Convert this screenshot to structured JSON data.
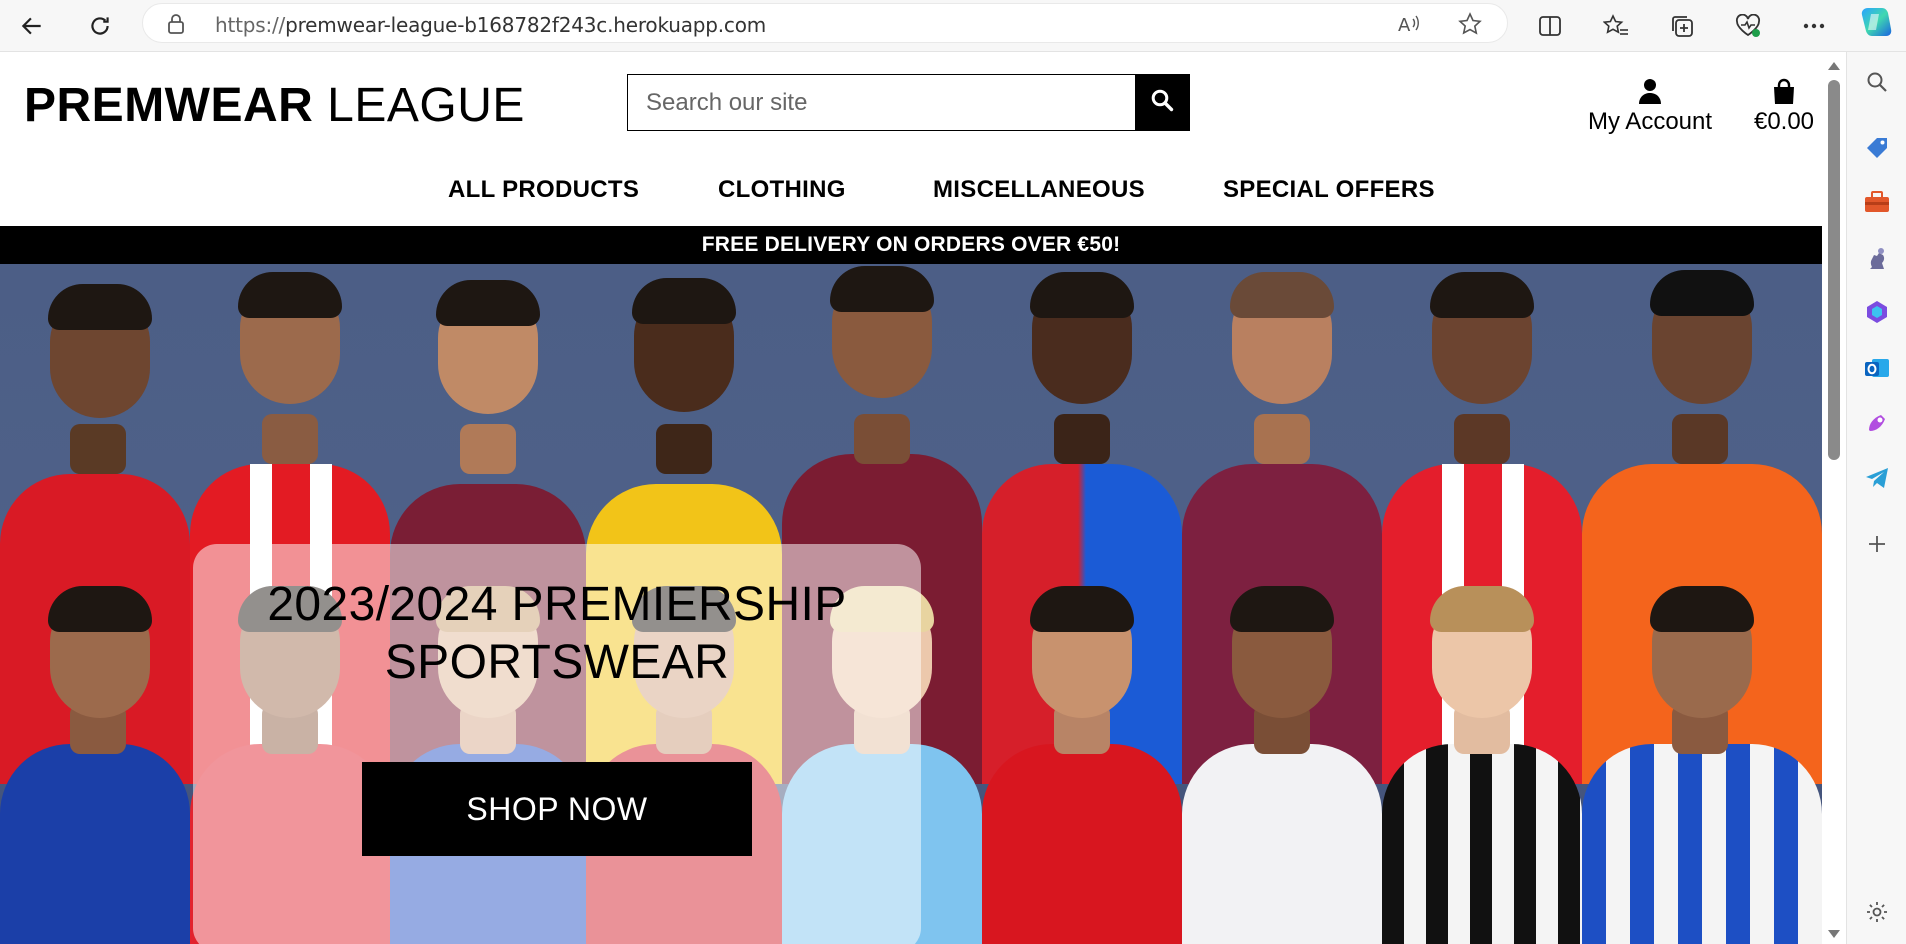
{
  "browser": {
    "url_protocol": "https://",
    "url_host": "premwear-league-b168782f243c.herokuapp.com",
    "buttons": [
      "back-icon",
      "refresh-icon",
      "read-aloud-icon",
      "favorite-star-icon",
      "split-screen-icon",
      "favorites-icon",
      "collections-icon",
      "browser-essentials-icon",
      "more-icon",
      "copilot-icon"
    ],
    "sidebar_icons": [
      "search-icon",
      "shopping-tag-icon",
      "tools-icon",
      "games-icon",
      "microsoft-365-icon",
      "outlook-icon",
      "designer-icon",
      "telegram-icon",
      "add-icon",
      "settings-icon"
    ]
  },
  "header": {
    "logo_bold": "PREMWEAR",
    "logo_light": "LEAGUE",
    "search_placeholder": "Search our site",
    "account_label": "My Account",
    "bag_total": "€0.00"
  },
  "nav": {
    "items": [
      "ALL PRODUCTS",
      "CLOTHING",
      "MISCELLANEOUS",
      "SPECIAL OFFERS"
    ]
  },
  "promo": {
    "text": "FREE DELIVERY ON ORDERS OVER €50!"
  },
  "hero": {
    "headline_line1": "2023/2024 PREMIERSHIP",
    "headline_line2": "SPORTSWEAR",
    "cta_label": "SHOP NOW"
  },
  "colors": {
    "brand_black": "#000000",
    "hero_background": "#4c5e86",
    "card_overlay": "rgba(255,255,255,0.52)"
  }
}
